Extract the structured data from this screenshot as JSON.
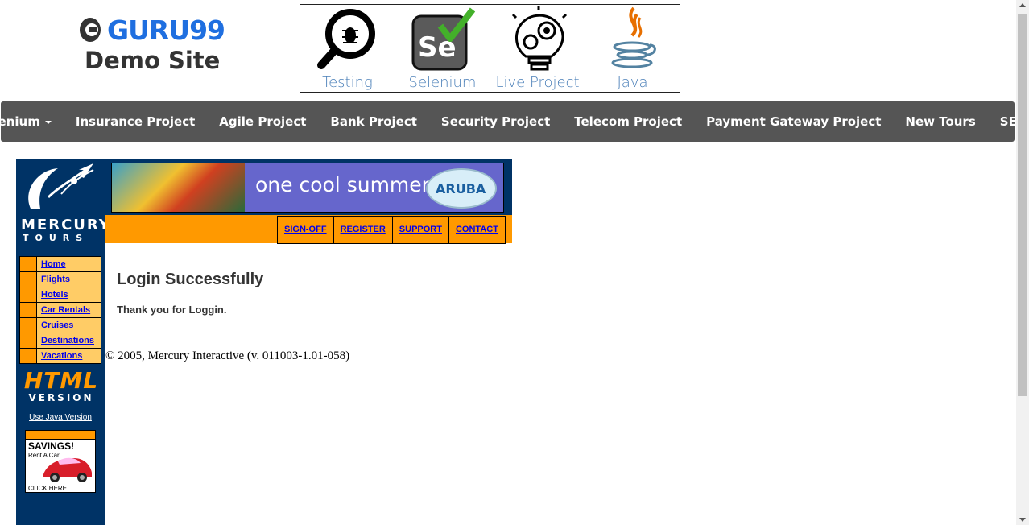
{
  "header": {
    "logo_brand": "GURU99",
    "logo_subtitle": "Demo Site",
    "tiles": [
      {
        "label": "Testing",
        "icon": "magnifier-bug-icon"
      },
      {
        "label": "Selenium",
        "icon": "selenium-check-icon"
      },
      {
        "label": "Live Project",
        "icon": "lightbulb-gear-icon"
      },
      {
        "label": "Java",
        "icon": "java-cup-icon"
      }
    ]
  },
  "nav": {
    "items": [
      "Selenium",
      "Insurance Project",
      "Agile Project",
      "Bank Project",
      "Security Project",
      "Telecom Project",
      "Payment Gateway Project",
      "New Tours",
      "SEO"
    ]
  },
  "mercury": {
    "brand_line1": "MERCURY",
    "brand_line2": "TOURS",
    "side_menu": [
      "Home",
      "Flights",
      "Hotels",
      "Car Rentals",
      "Cruises",
      "Destinations",
      "Vacations"
    ],
    "html_version_big": "HTML",
    "html_version_small": "VERSION",
    "java_link": "Use Java Version",
    "ad": {
      "savings": "SAVINGS!",
      "rent": "Rent A Car",
      "click": "CLICK HERE"
    },
    "banner_text": "one cool summer",
    "banner_logo": "ARUBA",
    "top_links": [
      "SIGN-OFF",
      "REGISTER",
      "SUPPORT",
      "CONTACT"
    ]
  },
  "main": {
    "title": "Login Successfully",
    "message": "Thank you for Loggin."
  },
  "footer": "© 2005, Mercury Interactive (v. 011003-1.01-058)"
}
